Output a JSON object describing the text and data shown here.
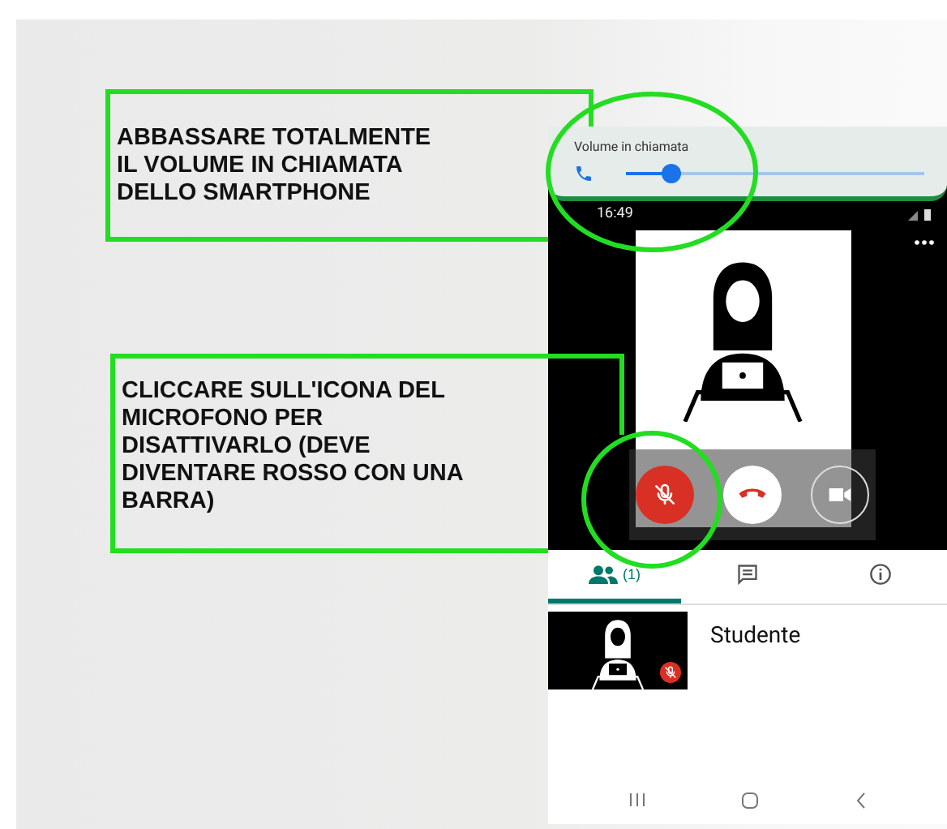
{
  "annotations": [
    {
      "lines": [
        "ABBASSARE TOTALMENTE",
        "IL VOLUME IN CHIAMATA",
        "DELLO SMARTPHONE"
      ]
    },
    {
      "lines": [
        "CLICCARE SULL'ICONA DEL",
        "MICROFONO PER",
        "DISATTIVARLO (DEVE",
        "DIVENTARE ROSSO CON UNA",
        "BARRA)"
      ]
    }
  ],
  "phone": {
    "volume_panel": {
      "title": "Volume in chiamata",
      "level": 0.15
    },
    "status_bar": {
      "time": "16:49"
    },
    "call_controls": [
      {
        "kind": "mic",
        "muted": true
      },
      {
        "kind": "hangup"
      },
      {
        "kind": "camera"
      }
    ],
    "tabs": [
      {
        "kind": "people",
        "label": "(1)",
        "selected": true
      },
      {
        "kind": "chat",
        "selected": false
      },
      {
        "kind": "info",
        "selected": false
      }
    ],
    "participants": [
      {
        "name": "Studente",
        "muted": true
      }
    ]
  }
}
